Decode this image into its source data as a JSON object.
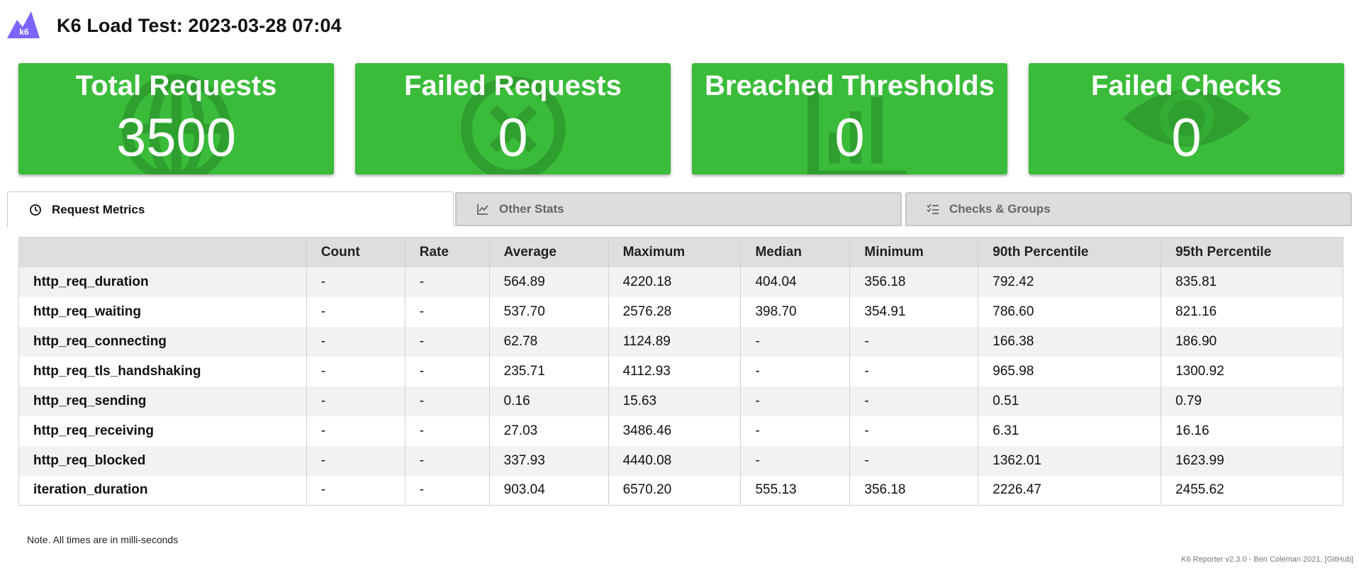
{
  "header": {
    "logo_text": "k6",
    "title": "K6 Load Test: 2023-03-28 07:04"
  },
  "summary": [
    {
      "title": "Total Requests",
      "value": "3500",
      "icon": "globe-icon"
    },
    {
      "title": "Failed Requests",
      "value": "0",
      "icon": "x-circle-icon"
    },
    {
      "title": "Breached Thresholds",
      "value": "0",
      "icon": "bar-chart-icon"
    },
    {
      "title": "Failed Checks",
      "value": "0",
      "icon": "eye-icon"
    }
  ],
  "colors": {
    "summary_green": "#3abc3a",
    "logo_purple": "#7d64ff"
  },
  "tabs": [
    {
      "label": "Request Metrics",
      "icon": "clock-icon",
      "active": true
    },
    {
      "label": "Other Stats",
      "icon": "line-chart-icon",
      "active": false
    },
    {
      "label": "Checks & Groups",
      "icon": "checklist-icon",
      "active": false
    }
  ],
  "table": {
    "columns": [
      "",
      "Count",
      "Rate",
      "Average",
      "Maximum",
      "Median",
      "Minimum",
      "90th Percentile",
      "95th Percentile"
    ],
    "rows": [
      [
        "http_req_duration",
        "-",
        "-",
        "564.89",
        "4220.18",
        "404.04",
        "356.18",
        "792.42",
        "835.81"
      ],
      [
        "http_req_waiting",
        "-",
        "-",
        "537.70",
        "2576.28",
        "398.70",
        "354.91",
        "786.60",
        "821.16"
      ],
      [
        "http_req_connecting",
        "-",
        "-",
        "62.78",
        "1124.89",
        "-",
        "-",
        "166.38",
        "186.90"
      ],
      [
        "http_req_tls_handshaking",
        "-",
        "-",
        "235.71",
        "4112.93",
        "-",
        "-",
        "965.98",
        "1300.92"
      ],
      [
        "http_req_sending",
        "-",
        "-",
        "0.16",
        "15.63",
        "-",
        "-",
        "0.51",
        "0.79"
      ],
      [
        "http_req_receiving",
        "-",
        "-",
        "27.03",
        "3486.46",
        "-",
        "-",
        "6.31",
        "16.16"
      ],
      [
        "http_req_blocked",
        "-",
        "-",
        "337.93",
        "4440.08",
        "-",
        "-",
        "1362.01",
        "1623.99"
      ],
      [
        "iteration_duration",
        "-",
        "-",
        "903.04",
        "6570.20",
        "555.13",
        "356.18",
        "2226.47",
        "2455.62"
      ]
    ]
  },
  "note": "Note. All times are in milli-seconds",
  "footer": {
    "text": "K6 Reporter v2.3.0 - Ben Coleman 2021, ",
    "link": "[GitHub]"
  }
}
